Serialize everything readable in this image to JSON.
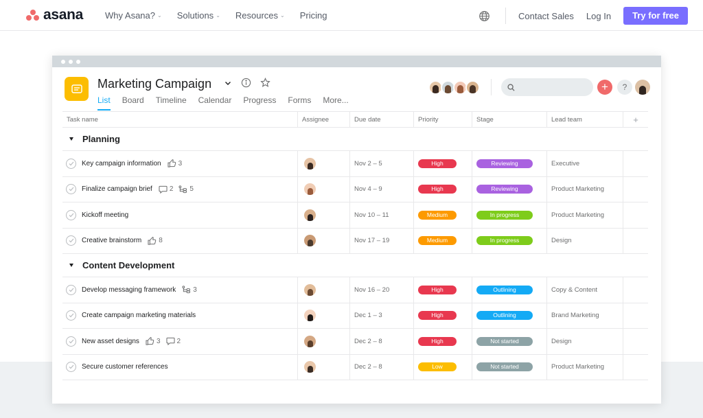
{
  "nav": {
    "logo_text": "asana",
    "links": [
      {
        "label": "Why Asana?",
        "has_dropdown": true
      },
      {
        "label": "Solutions",
        "has_dropdown": true
      },
      {
        "label": "Resources",
        "has_dropdown": true
      },
      {
        "label": "Pricing",
        "has_dropdown": false
      }
    ],
    "globe_icon": "globe-icon",
    "contact_sales": "Contact Sales",
    "login": "Log In",
    "cta": "Try for free",
    "cta_color": "#796eff"
  },
  "project": {
    "title": "Marketing Campaign",
    "icon_color": "#fcbd01",
    "tabs": [
      "List",
      "Board",
      "Timeline",
      "Calendar",
      "Progress",
      "Forms",
      "More..."
    ],
    "active_tab": "List"
  },
  "table": {
    "columns": [
      "Task name",
      "Assignee",
      "Due date",
      "Priority",
      "Stage",
      "Lead team"
    ],
    "add_column": "+",
    "sections": [
      {
        "name": "Planning",
        "tasks": [
          {
            "name": "Key campaign information",
            "likes": "3",
            "due": "Nov 2 – 5",
            "priority": "High",
            "stage": "Reviewing",
            "lead": "Executive"
          },
          {
            "name": "Finalize campaign brief",
            "comments": "2",
            "subtasks": "5",
            "due": "Nov 4 – 9",
            "priority": "High",
            "stage": "Reviewing",
            "lead": "Product Marketing"
          },
          {
            "name": "Kickoff meeting",
            "due": "Nov 10 – 11",
            "priority": "Medium",
            "stage": "In progress",
            "lead": "Product Marketing"
          },
          {
            "name": "Creative brainstorm",
            "likes": "8",
            "due": "Nov 17 – 19",
            "priority": "Medium",
            "stage": "In progress",
            "lead": "Design"
          }
        ]
      },
      {
        "name": "Content Development",
        "tasks": [
          {
            "name": "Develop messaging framework",
            "subtasks": "3",
            "due": "Nov 16 – 20",
            "priority": "High",
            "stage": "Outlining",
            "lead": "Copy & Content"
          },
          {
            "name": "Create campaign marketing materials",
            "due": "Dec 1 – 3",
            "priority": "High",
            "stage": "Outlining",
            "lead": "Brand Marketing"
          },
          {
            "name": "New asset designs",
            "likes": "3",
            "comments": "2",
            "due": "Dec 2 – 8",
            "priority": "High",
            "stage": "Not started",
            "lead": "Design"
          },
          {
            "name": "Secure customer references",
            "due": "Dec 2 – 8",
            "priority": "Low",
            "stage": "Not started",
            "lead": "Product Marketing"
          }
        ]
      }
    ]
  },
  "colors": {
    "priority": {
      "High": "#e8384f",
      "Medium": "#fd9a00",
      "Low": "#fcbd01"
    },
    "stage": {
      "Reviewing": "#a962e0",
      "In progress": "#7ecc1b",
      "Outlining": "#14aaf5",
      "Not started": "#8da3a6"
    },
    "tab_active": "#14aaf5",
    "add_button": "#f06a6a"
  }
}
